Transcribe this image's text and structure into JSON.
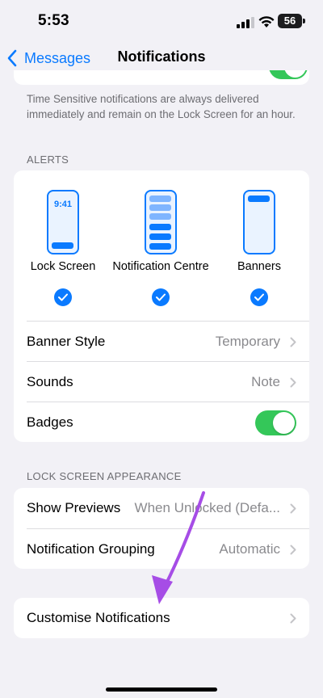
{
  "status_bar": {
    "time": "5:53",
    "battery": "56"
  },
  "nav": {
    "back_label": "Messages",
    "title": "Notifications"
  },
  "time_sensitive_footer": "Time Sensitive notifications are always delivered immediately and remain on the Lock Screen for an hour.",
  "alerts": {
    "header": "ALERTS",
    "options": [
      {
        "label": "Lock Screen",
        "phone_time": "9:41",
        "checked": true
      },
      {
        "label": "Notification Centre",
        "checked": true
      },
      {
        "label": "Banners",
        "checked": true
      }
    ],
    "rows": {
      "banner_style": {
        "label": "Banner Style",
        "value": "Temporary"
      },
      "sounds": {
        "label": "Sounds",
        "value": "Note"
      },
      "badges": {
        "label": "Badges",
        "enabled": true
      }
    }
  },
  "lock_screen_appearance": {
    "header": "LOCK SCREEN APPEARANCE",
    "show_previews": {
      "label": "Show Previews",
      "value": "When Unlocked (Defa..."
    },
    "notification_grouping": {
      "label": "Notification Grouping",
      "value": "Automatic"
    }
  },
  "customise": {
    "label": "Customise Notifications"
  },
  "colors": {
    "accent": "#0a7aff",
    "toggle_on": "#34c759",
    "annotation_arrow": "#a64de6",
    "background": "#f2f1f6"
  }
}
